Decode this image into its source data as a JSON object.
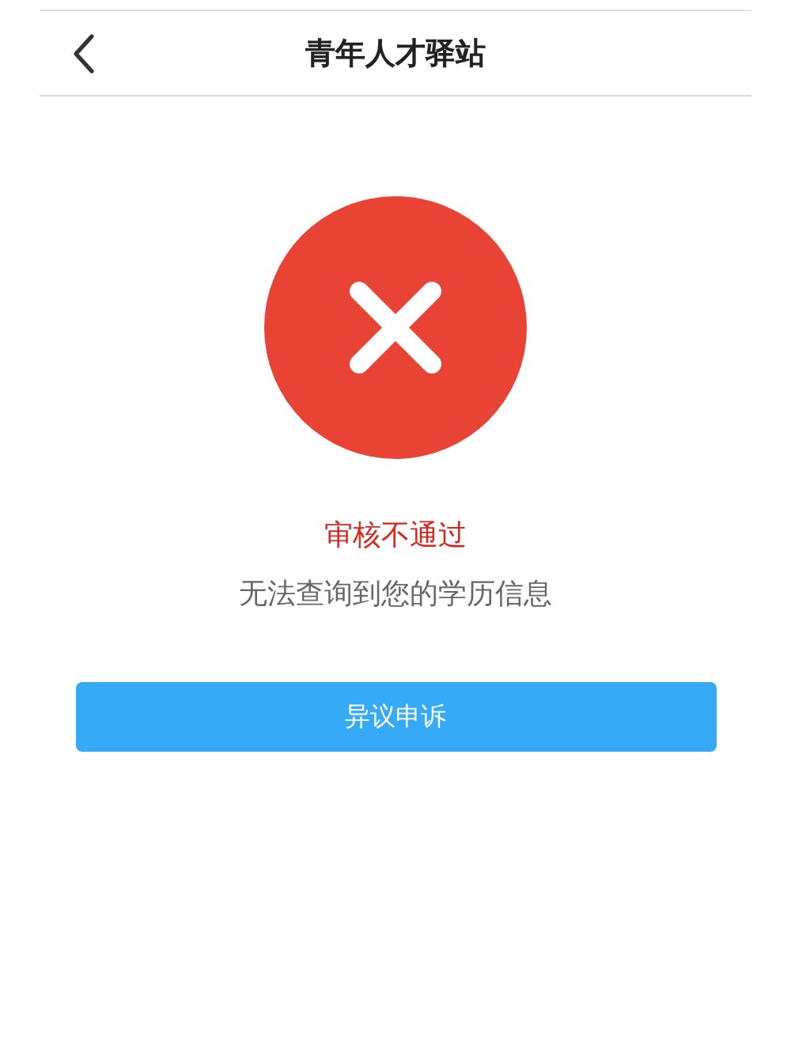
{
  "header": {
    "title": "青年人才驿站"
  },
  "result": {
    "kind": "failure",
    "status": "审核不通过",
    "message": "无法查询到您的学历信息"
  },
  "buttons": [
    "异议申诉"
  ]
}
